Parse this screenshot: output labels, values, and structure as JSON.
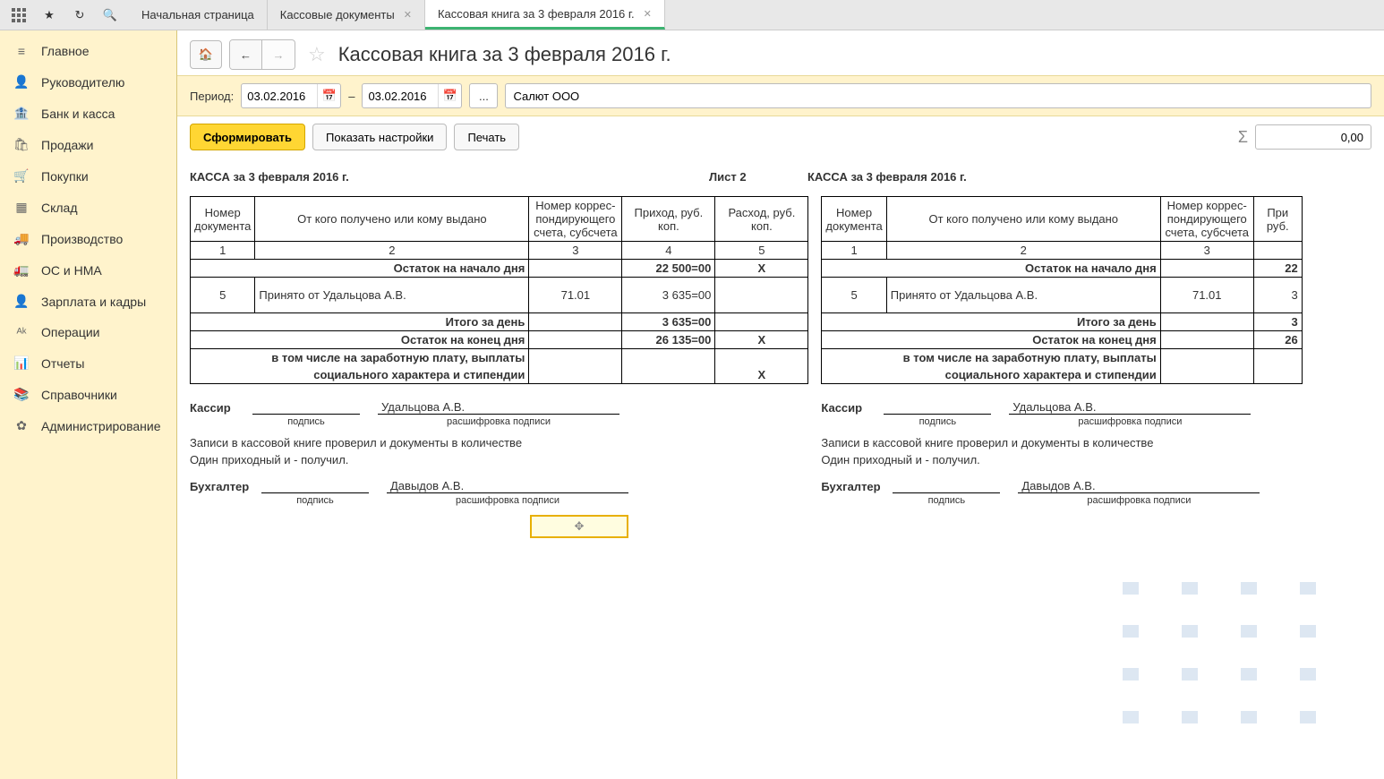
{
  "tabs": [
    {
      "label": "Начальная страница"
    },
    {
      "label": "Кассовые документы"
    },
    {
      "label": "Кассовая книга за 3 февраля 2016 г."
    }
  ],
  "sidebar": {
    "items": [
      {
        "icon": "≡",
        "label": "Главное"
      },
      {
        "icon": "👤",
        "label": "Руководителю"
      },
      {
        "icon": "🏦",
        "label": "Банк и касса"
      },
      {
        "icon": "🛍",
        "label": "Продажи"
      },
      {
        "icon": "🛒",
        "label": "Покупки"
      },
      {
        "icon": "▦",
        "label": "Склад"
      },
      {
        "icon": "🚚",
        "label": "Производство"
      },
      {
        "icon": "🚛",
        "label": "ОС и НМА"
      },
      {
        "icon": "👤",
        "label": "Зарплата и кадры"
      },
      {
        "icon": "ᴬᵏ",
        "label": "Операции"
      },
      {
        "icon": "📊",
        "label": "Отчеты"
      },
      {
        "icon": "📚",
        "label": "Справочники"
      },
      {
        "icon": "✿",
        "label": "Администрирование"
      }
    ]
  },
  "page": {
    "title": "Кассовая книга за 3 февраля 2016 г."
  },
  "period": {
    "label": "Период:",
    "from": "03.02.2016",
    "dash": "–",
    "to": "03.02.2016",
    "org": "Салют ООО"
  },
  "actions": {
    "form": "Сформировать",
    "settings": "Показать настройки",
    "print": "Печать",
    "sum": "0,00"
  },
  "report": {
    "header1": "КАССА за 3 февраля 2016 г.",
    "sheet": "Лист 2",
    "header2": "КАССА за 3 февраля 2016 г.",
    "cols": {
      "c1": "Номер документа",
      "c2": "От кого получено или кому выдано",
      "c3": "Номер коррес-пондирующего счета, субсчета",
      "c4": "Приход, руб. коп.",
      "c5": "Расход, руб. коп.",
      "c4s": "При руб."
    },
    "nums": {
      "n1": "1",
      "n2": "2",
      "n3": "3",
      "n4": "4",
      "n5": "5"
    },
    "rows": {
      "open_label": "Остаток на начало дня",
      "open_in": "22 500=00",
      "open_out": "X",
      "r1_num": "5",
      "r1_name": "Принято от Удальцова А.В.",
      "r1_acc": "71.01",
      "r1_in": "3 635=00",
      "r1b_in": "22",
      "r1b_in2": "3",
      "day_label": "Итого за день",
      "day_in": "3 635=00",
      "close_label": "Остаток на конец  дня",
      "close_in": "26 135=00",
      "close_out": "X",
      "close_in2": "26",
      "sal_label1": "в том числе на заработную плату, выплаты",
      "sal_label2": "социального характера и стипендии",
      "sal_out": "X"
    },
    "sig": {
      "cashier": "Кассир",
      "cashier_name": "Удальцова А.В.",
      "sign_lbl": "подпись",
      "decode_lbl": "расшифровка подписи",
      "check_line": "Записи в кассовой книге проверил и документы в количестве",
      "one_line": "Один приходный и  -  получил.",
      "accountant": "Бухгалтер",
      "accountant_name": "Давыдов А.В."
    }
  }
}
